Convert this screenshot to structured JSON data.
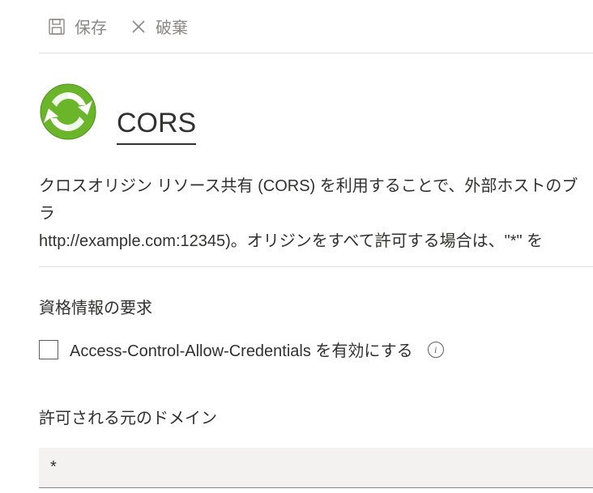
{
  "toolbar": {
    "save_label": "保存",
    "discard_label": "破棄"
  },
  "header": {
    "title": "CORS"
  },
  "description": {
    "line1": "クロスオリジン リソース共有 (CORS) を利用することで、外部ホストのブラ",
    "line2": "http://example.com:12345)。オリジンをすべて許可する場合は、\"*\" を"
  },
  "credentials": {
    "section_label": "資格情報の要求",
    "checkbox_label": "Access-Control-Allow-Credentials を有効にする",
    "info_glyph": "i"
  },
  "origins": {
    "section_label": "許可される元のドメイン",
    "input_value": "*"
  },
  "icons": {
    "app_icon_bg": "#6bb52a",
    "app_icon_fg": "#ffffff"
  }
}
